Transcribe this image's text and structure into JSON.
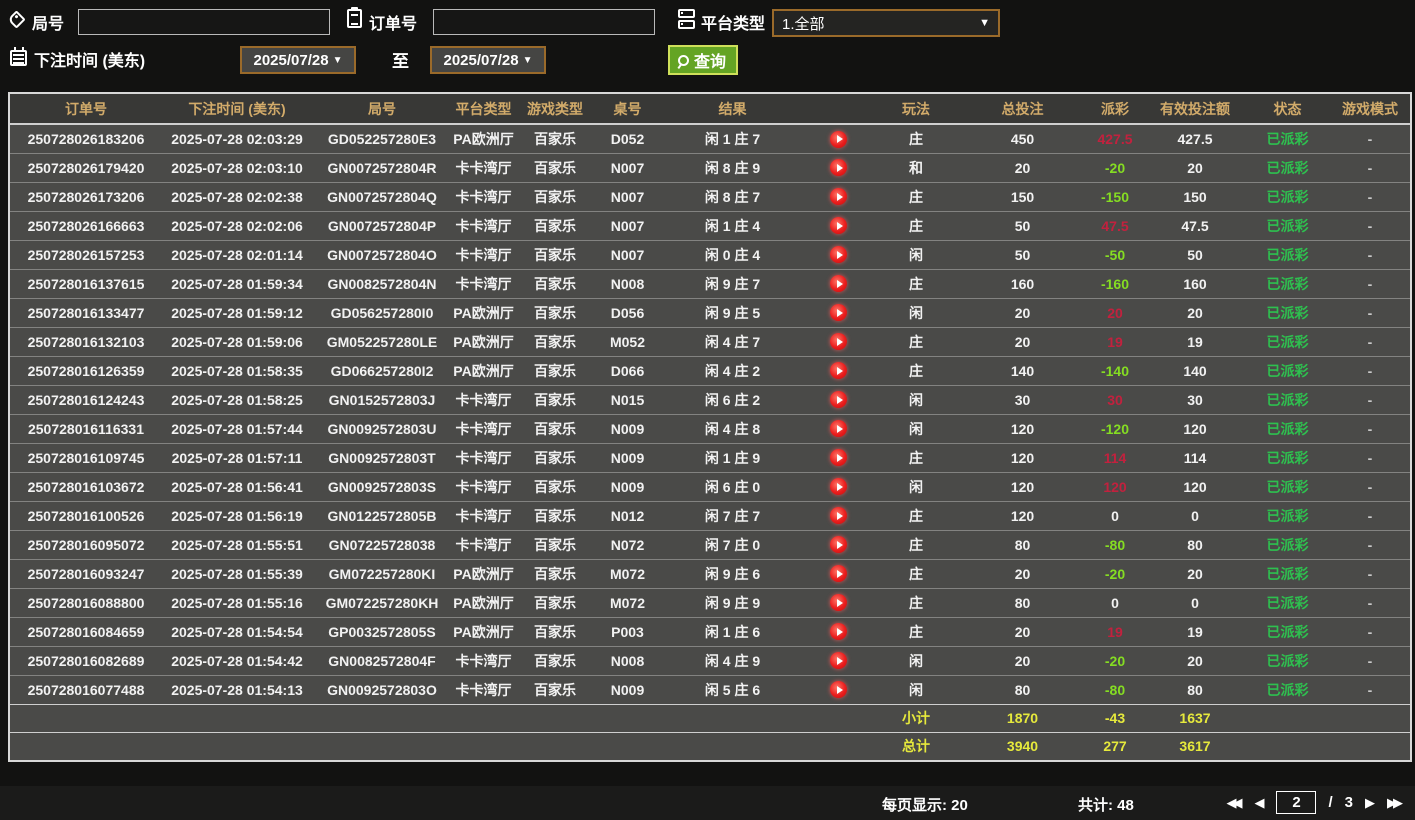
{
  "filters": {
    "round_label": "局号",
    "round_value": "",
    "order_label": "订单号",
    "order_value": "",
    "platform_label": "平台类型",
    "platform_value": "1.全部",
    "bet_time_label": "下注时间 (美东)",
    "date_from": "2025/07/28",
    "to_label": "至",
    "date_to": "2025/07/28",
    "search_label": "查询"
  },
  "table": {
    "headers": [
      "订单号",
      "下注时间 (美东)",
      "局号",
      "平台类型",
      "游戏类型",
      "桌号",
      "结果",
      "玩法",
      "总投注",
      "派彩",
      "有效投注额",
      "状态",
      "游戏模式"
    ],
    "rows": [
      {
        "order": "250728026183206",
        "time": "2025-07-28 02:03:29",
        "round": "GD052257280E3",
        "platform": "PA欧洲厅",
        "game_type": "百家乐",
        "table_no": "D052",
        "result": "闲 1 庄 7",
        "play_method": "庄",
        "total_bet": "450",
        "payout": "427.5",
        "payout_sign": "pos",
        "valid_bet": "427.5",
        "status": "已派彩",
        "game_mode": "-"
      },
      {
        "order": "250728026179420",
        "time": "2025-07-28 02:03:10",
        "round": "GN0072572804R",
        "platform": "卡卡湾厅",
        "game_type": "百家乐",
        "table_no": "N007",
        "result": "闲 8 庄 9",
        "play_method": "和",
        "total_bet": "20",
        "payout": "-20",
        "payout_sign": "neg",
        "valid_bet": "20",
        "status": "已派彩",
        "game_mode": "-"
      },
      {
        "order": "250728026173206",
        "time": "2025-07-28 02:02:38",
        "round": "GN0072572804Q",
        "platform": "卡卡湾厅",
        "game_type": "百家乐",
        "table_no": "N007",
        "result": "闲 8 庄 7",
        "play_method": "庄",
        "total_bet": "150",
        "payout": "-150",
        "payout_sign": "neg",
        "valid_bet": "150",
        "status": "已派彩",
        "game_mode": "-"
      },
      {
        "order": "250728026166663",
        "time": "2025-07-28 02:02:06",
        "round": "GN0072572804P",
        "platform": "卡卡湾厅",
        "game_type": "百家乐",
        "table_no": "N007",
        "result": "闲 1 庄 4",
        "play_method": "庄",
        "total_bet": "50",
        "payout": "47.5",
        "payout_sign": "pos",
        "valid_bet": "47.5",
        "status": "已派彩",
        "game_mode": "-"
      },
      {
        "order": "250728026157253",
        "time": "2025-07-28 02:01:14",
        "round": "GN0072572804O",
        "platform": "卡卡湾厅",
        "game_type": "百家乐",
        "table_no": "N007",
        "result": "闲 0 庄 4",
        "play_method": "闲",
        "total_bet": "50",
        "payout": "-50",
        "payout_sign": "neg",
        "valid_bet": "50",
        "status": "已派彩",
        "game_mode": "-"
      },
      {
        "order": "250728016137615",
        "time": "2025-07-28 01:59:34",
        "round": "GN0082572804N",
        "platform": "卡卡湾厅",
        "game_type": "百家乐",
        "table_no": "N008",
        "result": "闲 9 庄 7",
        "play_method": "庄",
        "total_bet": "160",
        "payout": "-160",
        "payout_sign": "neg",
        "valid_bet": "160",
        "status": "已派彩",
        "game_mode": "-"
      },
      {
        "order": "250728016133477",
        "time": "2025-07-28 01:59:12",
        "round": "GD056257280I0",
        "platform": "PA欧洲厅",
        "game_type": "百家乐",
        "table_no": "D056",
        "result": "闲 9 庄 5",
        "play_method": "闲",
        "total_bet": "20",
        "payout": "20",
        "payout_sign": "pos",
        "valid_bet": "20",
        "status": "已派彩",
        "game_mode": "-"
      },
      {
        "order": "250728016132103",
        "time": "2025-07-28 01:59:06",
        "round": "GM052257280LE",
        "platform": "PA欧洲厅",
        "game_type": "百家乐",
        "table_no": "M052",
        "result": "闲 4 庄 7",
        "play_method": "庄",
        "total_bet": "20",
        "payout": "19",
        "payout_sign": "pos",
        "valid_bet": "19",
        "status": "已派彩",
        "game_mode": "-"
      },
      {
        "order": "250728016126359",
        "time": "2025-07-28 01:58:35",
        "round": "GD066257280I2",
        "platform": "PA欧洲厅",
        "game_type": "百家乐",
        "table_no": "D066",
        "result": "闲 4 庄 2",
        "play_method": "庄",
        "total_bet": "140",
        "payout": "-140",
        "payout_sign": "neg",
        "valid_bet": "140",
        "status": "已派彩",
        "game_mode": "-"
      },
      {
        "order": "250728016124243",
        "time": "2025-07-28 01:58:25",
        "round": "GN0152572803J",
        "platform": "卡卡湾厅",
        "game_type": "百家乐",
        "table_no": "N015",
        "result": "闲 6 庄 2",
        "play_method": "闲",
        "total_bet": "30",
        "payout": "30",
        "payout_sign": "pos",
        "valid_bet": "30",
        "status": "已派彩",
        "game_mode": "-"
      },
      {
        "order": "250728016116331",
        "time": "2025-07-28 01:57:44",
        "round": "GN0092572803U",
        "platform": "卡卡湾厅",
        "game_type": "百家乐",
        "table_no": "N009",
        "result": "闲 4 庄 8",
        "play_method": "闲",
        "total_bet": "120",
        "payout": "-120",
        "payout_sign": "neg",
        "valid_bet": "120",
        "status": "已派彩",
        "game_mode": "-"
      },
      {
        "order": "250728016109745",
        "time": "2025-07-28 01:57:11",
        "round": "GN0092572803T",
        "platform": "卡卡湾厅",
        "game_type": "百家乐",
        "table_no": "N009",
        "result": "闲 1 庄 9",
        "play_method": "庄",
        "total_bet": "120",
        "payout": "114",
        "payout_sign": "pos",
        "valid_bet": "114",
        "status": "已派彩",
        "game_mode": "-"
      },
      {
        "order": "250728016103672",
        "time": "2025-07-28 01:56:41",
        "round": "GN0092572803S",
        "platform": "卡卡湾厅",
        "game_type": "百家乐",
        "table_no": "N009",
        "result": "闲 6 庄 0",
        "play_method": "闲",
        "total_bet": "120",
        "payout": "120",
        "payout_sign": "pos",
        "valid_bet": "120",
        "status": "已派彩",
        "game_mode": "-"
      },
      {
        "order": "250728016100526",
        "time": "2025-07-28 01:56:19",
        "round": "GN0122572805B",
        "platform": "卡卡湾厅",
        "game_type": "百家乐",
        "table_no": "N012",
        "result": "闲 7 庄 7",
        "play_method": "庄",
        "total_bet": "120",
        "payout": "0",
        "payout_sign": "zero",
        "valid_bet": "0",
        "status": "已派彩",
        "game_mode": "-"
      },
      {
        "order": "250728016095072",
        "time": "2025-07-28 01:55:51",
        "round": "GN07225728038",
        "platform": "卡卡湾厅",
        "game_type": "百家乐",
        "table_no": "N072",
        "result": "闲 7 庄 0",
        "play_method": "庄",
        "total_bet": "80",
        "payout": "-80",
        "payout_sign": "neg",
        "valid_bet": "80",
        "status": "已派彩",
        "game_mode": "-"
      },
      {
        "order": "250728016093247",
        "time": "2025-07-28 01:55:39",
        "round": "GM072257280KI",
        "platform": "PA欧洲厅",
        "game_type": "百家乐",
        "table_no": "M072",
        "result": "闲 9 庄 6",
        "play_method": "庄",
        "total_bet": "20",
        "payout": "-20",
        "payout_sign": "neg",
        "valid_bet": "20",
        "status": "已派彩",
        "game_mode": "-"
      },
      {
        "order": "250728016088800",
        "time": "2025-07-28 01:55:16",
        "round": "GM072257280KH",
        "platform": "PA欧洲厅",
        "game_type": "百家乐",
        "table_no": "M072",
        "result": "闲 9 庄 9",
        "play_method": "庄",
        "total_bet": "80",
        "payout": "0",
        "payout_sign": "zero",
        "valid_bet": "0",
        "status": "已派彩",
        "game_mode": "-"
      },
      {
        "order": "250728016084659",
        "time": "2025-07-28 01:54:54",
        "round": "GP0032572805S",
        "platform": "PA欧洲厅",
        "game_type": "百家乐",
        "table_no": "P003",
        "result": "闲 1 庄 6",
        "play_method": "庄",
        "total_bet": "20",
        "payout": "19",
        "payout_sign": "pos",
        "valid_bet": "19",
        "status": "已派彩",
        "game_mode": "-"
      },
      {
        "order": "250728016082689",
        "time": "2025-07-28 01:54:42",
        "round": "GN0082572804F",
        "platform": "卡卡湾厅",
        "game_type": "百家乐",
        "table_no": "N008",
        "result": "闲 4 庄 9",
        "play_method": "闲",
        "total_bet": "20",
        "payout": "-20",
        "payout_sign": "neg",
        "valid_bet": "20",
        "status": "已派彩",
        "game_mode": "-"
      },
      {
        "order": "250728016077488",
        "time": "2025-07-28 01:54:13",
        "round": "GN0092572803O",
        "platform": "卡卡湾厅",
        "game_type": "百家乐",
        "table_no": "N009",
        "result": "闲 5 庄 6",
        "play_method": "闲",
        "total_bet": "80",
        "payout": "-80",
        "payout_sign": "neg",
        "valid_bet": "80",
        "status": "已派彩",
        "game_mode": "-"
      }
    ],
    "subtotal": {
      "label": "小计",
      "total_bet": "1870",
      "payout": "-43",
      "valid_bet": "1637"
    },
    "grand_total": {
      "label": "总计",
      "total_bet": "3940",
      "payout": "277",
      "valid_bet": "3617"
    }
  },
  "pagination": {
    "per_page_label": "每页显示:",
    "per_page_value": "20",
    "total_label": "共计:",
    "total_value": "48",
    "current_page": "2",
    "separator": "/",
    "total_pages": "3"
  },
  "colors": {
    "accent_orange_border": "#9a6a2a",
    "search_button_green": "#64a424",
    "header_gold": "#d2ab6a",
    "payout_win_red": "#c2213e",
    "payout_loss_green": "#85dd22",
    "status_green": "#2ec04f",
    "totals_yellow": "#e6e93c",
    "play_icon_red": "#ea1d1d"
  }
}
